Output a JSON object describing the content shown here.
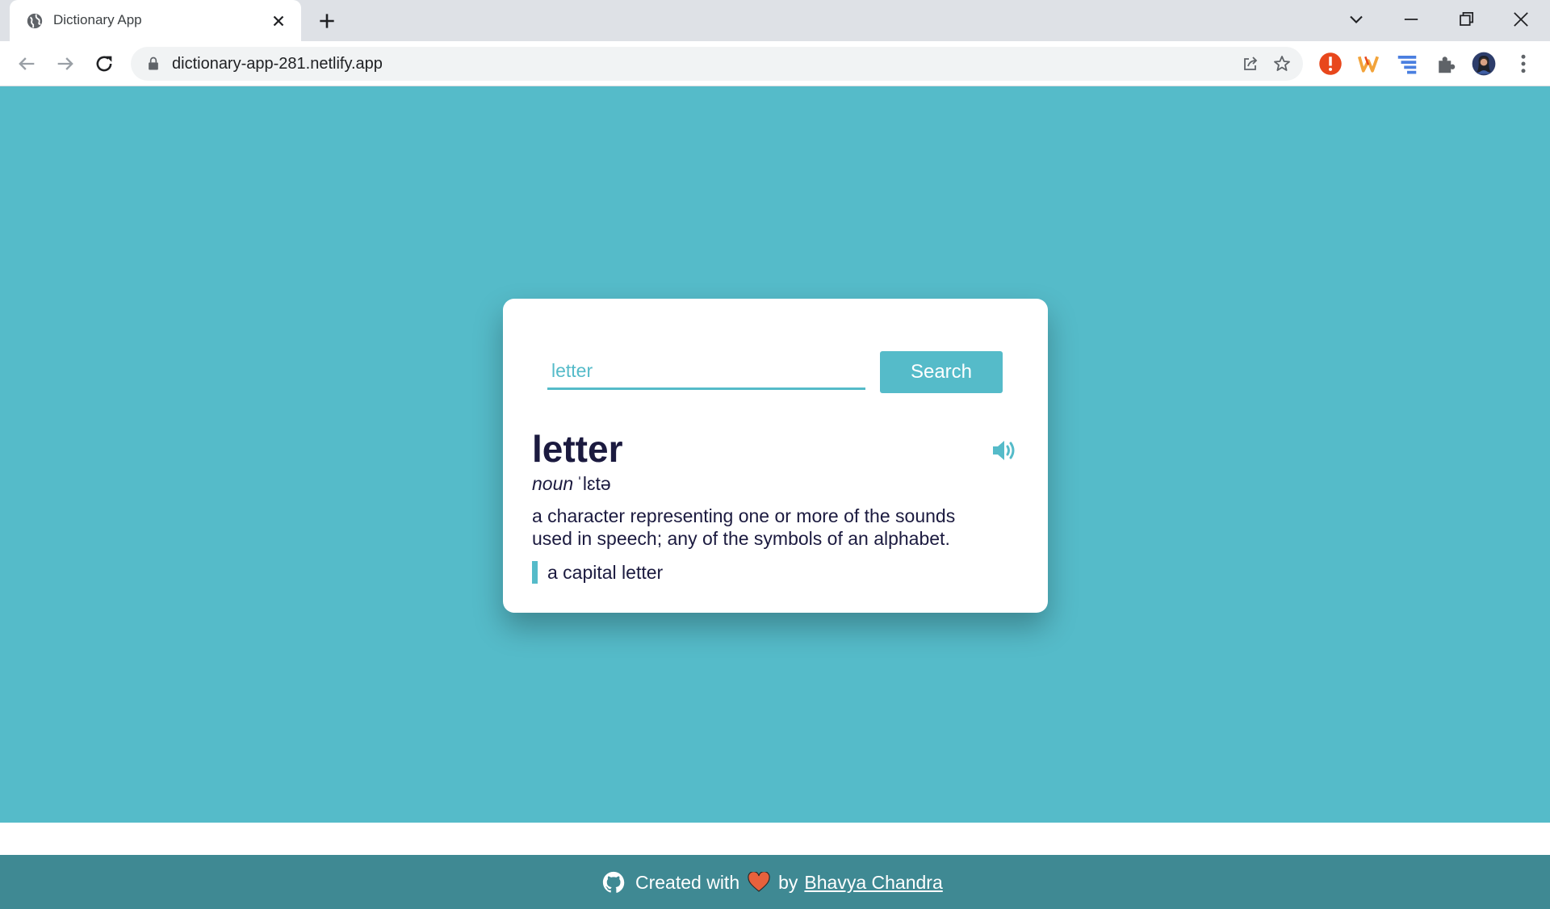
{
  "browser": {
    "tab_title": "Dictionary App",
    "url": "dictionary-app-281.netlify.app"
  },
  "search": {
    "value": "letter",
    "button_label": "Search"
  },
  "result": {
    "word": "letter",
    "part_of_speech": "noun",
    "phonetic": "ˈlɛtə",
    "definition": "a character representing one or more of the sounds used in speech; any of the symbols of an alphabet.",
    "example": "a capital letter"
  },
  "footer": {
    "created_with": "Created with",
    "by": "by",
    "author": "Bhavya Chandra"
  },
  "colors": {
    "accent": "#55bbc9",
    "footer": "#3f8993",
    "word_text": "#1b1a3f"
  }
}
